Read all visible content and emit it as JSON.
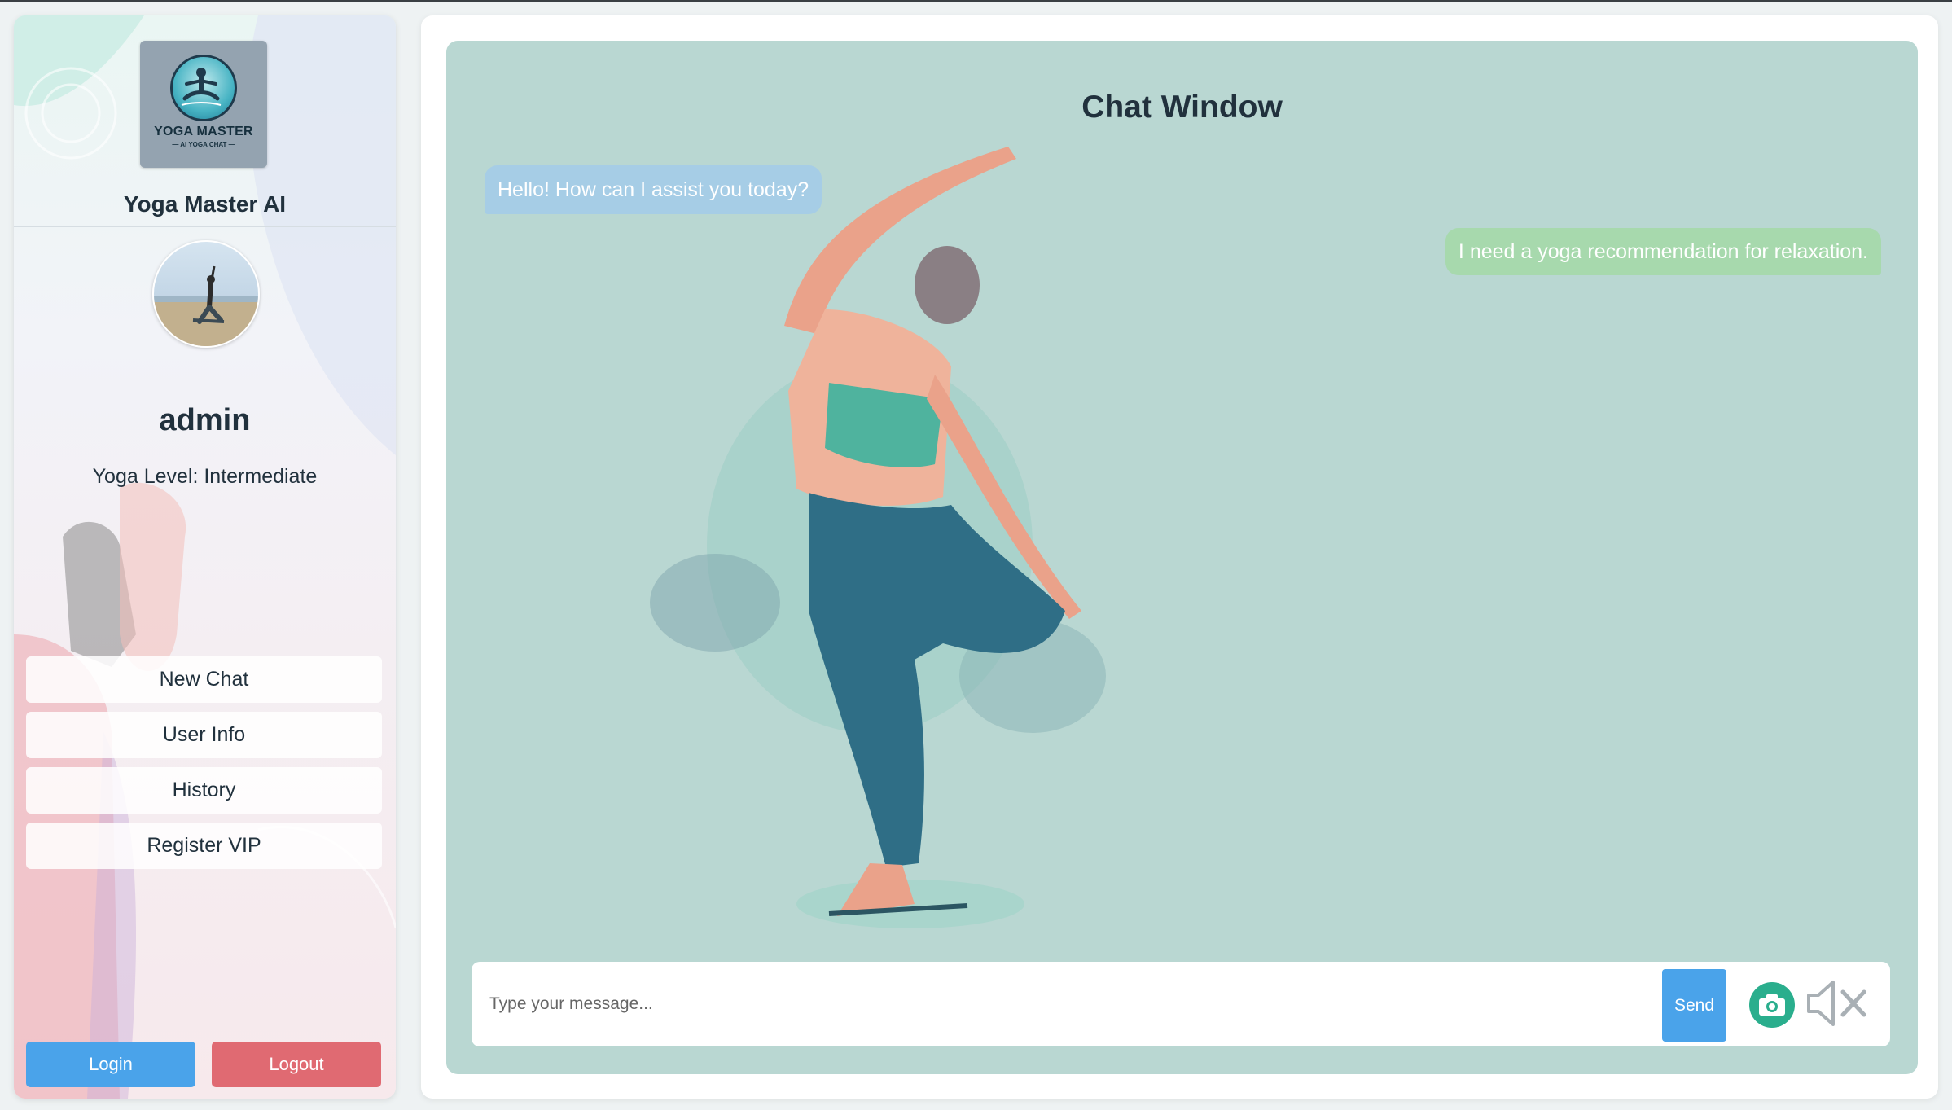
{
  "app": {
    "name": "Yoga Master AI",
    "logo_text": "YOGA MASTER",
    "logo_subtext": "— AI YOGA CHAT —"
  },
  "user": {
    "name": "admin",
    "level": "Yoga Level: Intermediate"
  },
  "menu": {
    "items": [
      {
        "label": "New Chat"
      },
      {
        "label": "User Info"
      },
      {
        "label": "History"
      },
      {
        "label": "Register VIP"
      }
    ]
  },
  "auth": {
    "login_label": "Login",
    "logout_label": "Logout"
  },
  "chat": {
    "title": "Chat Window",
    "messages": [
      {
        "role": "bot",
        "text": "Hello! How can I assist you today?"
      },
      {
        "role": "user",
        "text": "I need a yoga recommendation for relaxation."
      }
    ],
    "input_placeholder": "Type your message...",
    "send_label": "Send"
  },
  "icons": {
    "camera": "camera-icon",
    "mute": "speaker-muted-icon"
  },
  "colors": {
    "primary": "#4aa3ea",
    "danger": "#e06a72",
    "chat_bg": "#b9d7d2",
    "bot_bubble": "#a6cde6",
    "user_bubble": "#a7d9ad",
    "camera": "#2aae8d"
  }
}
